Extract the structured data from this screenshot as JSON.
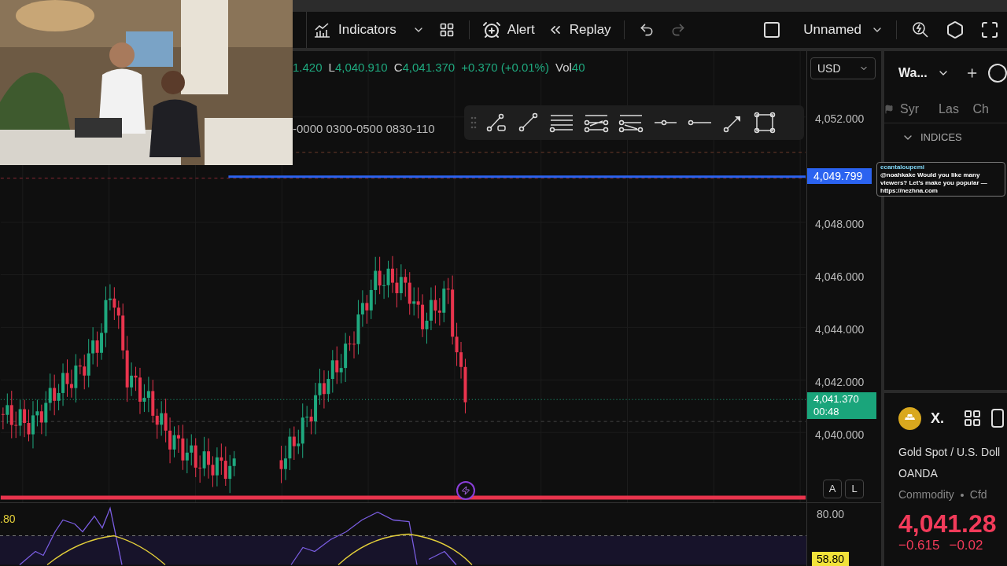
{
  "toolbar": {
    "items": [
      {
        "kind": "labeled",
        "label": "Indicators",
        "caret": true
      },
      {
        "kind": "icon"
      },
      {
        "kind": "labeled",
        "label": "Alert",
        "caret": false
      },
      {
        "kind": "labeled",
        "label": "Replay",
        "caret": false
      },
      {
        "kind": "icon",
        "disabled": false
      },
      {
        "kind": "icon",
        "disabled": true
      }
    ],
    "layout_name": "Unnamed"
  },
  "legend": {
    "parts": [
      {
        "value": "1.420"
      },
      {
        "label": "L",
        "value": "4,040.910"
      },
      {
        "label": "C",
        "value": "4,041.370"
      },
      {
        "value": "+0.370 (+0.01%)"
      },
      {
        "label": "Vol",
        "value": "40"
      }
    ]
  },
  "sessions": "-0000 0300-0500 0830-110",
  "currency": "USD",
  "price_axis": {
    "ticks": [
      "4,052.000",
      "4,048.000",
      "4,046.000",
      "4,044.000",
      "4,042.000",
      "4,040.000"
    ],
    "line_tag": "4,049.799",
    "last_price": "4,041.370",
    "countdown": "00:48",
    "scale_buttons": [
      {
        "label": "A",
        "selected": false
      },
      {
        "label": "L",
        "selected": false
      }
    ]
  },
  "indicator_pane": {
    "left_value": ".80",
    "level": "80.00",
    "tag": "58.80"
  },
  "watchlist": {
    "title": "Wa...",
    "columns": [
      "Syr",
      "Las",
      "Ch"
    ],
    "group": {
      "label": "INDICES",
      "expanded": true
    }
  },
  "chat_overlay": {
    "user": "ecantaloupemi",
    "message": "@noahkake Would you like many viewers? Let's make you popular — https://nezhna.com"
  },
  "details": {
    "symbol": "X.",
    "name": "Gold Spot / U.S. Doll",
    "exchange": "OANDA",
    "type": "Commodity",
    "subtype": "Cfd",
    "price": "4,041.28",
    "change": "−0.615",
    "change_percent": "−0.02"
  }
}
